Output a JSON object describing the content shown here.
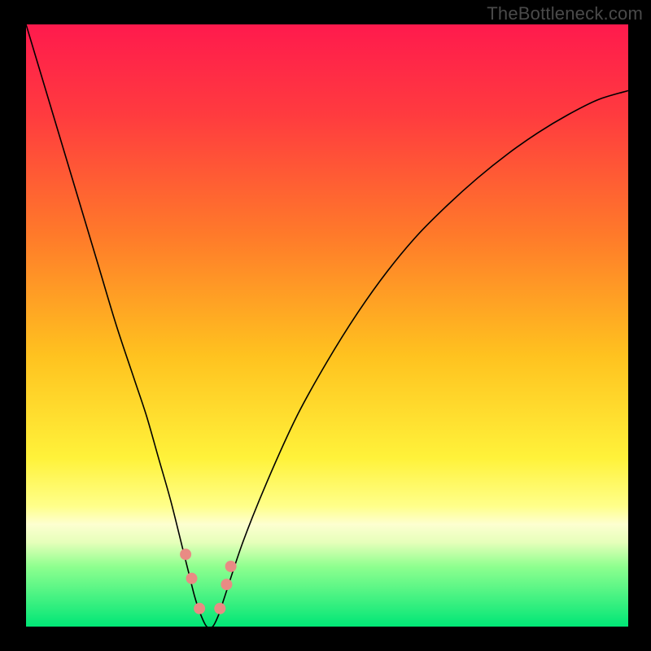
{
  "watermark": "TheBottleneck.com",
  "chart_data": {
    "type": "line",
    "title": "",
    "xlabel": "",
    "ylabel": "",
    "xlim": [
      0,
      100
    ],
    "ylim": [
      0,
      100
    ],
    "grid": false,
    "legend": false,
    "background_gradient": {
      "stops": [
        {
          "offset": 0.0,
          "color": "#ff1a4d"
        },
        {
          "offset": 0.15,
          "color": "#ff3b3f"
        },
        {
          "offset": 0.35,
          "color": "#ff7a2a"
        },
        {
          "offset": 0.55,
          "color": "#ffc21f"
        },
        {
          "offset": 0.72,
          "color": "#fff23a"
        },
        {
          "offset": 0.8,
          "color": "#ffff8a"
        },
        {
          "offset": 0.83,
          "color": "#fdffd0"
        },
        {
          "offset": 0.86,
          "color": "#e6ffba"
        },
        {
          "offset": 0.9,
          "color": "#8fff8f"
        },
        {
          "offset": 1.0,
          "color": "#00e676"
        }
      ]
    },
    "series": [
      {
        "name": "bottleneck-curve",
        "color": "#000000",
        "width": 1.6,
        "x": [
          0,
          3,
          6,
          9,
          12,
          15,
          18,
          20,
          22,
          24,
          26,
          27,
          28,
          29,
          30,
          31,
          32,
          33,
          36,
          40,
          45,
          50,
          55,
          60,
          65,
          70,
          75,
          80,
          85,
          90,
          95,
          100
        ],
        "y": [
          100,
          90,
          80,
          70,
          60,
          50,
          41,
          35,
          28,
          21,
          13,
          9,
          5,
          2,
          0,
          0,
          2,
          5,
          14,
          24,
          35,
          44,
          52,
          59,
          65,
          70,
          74.5,
          78.5,
          82,
          85,
          87.5,
          89
        ]
      }
    ],
    "markers": {
      "name": "bottleneck-markers",
      "color": "#e98b84",
      "size": 14,
      "points": [
        {
          "x": 26.5,
          "y": 12
        },
        {
          "x": 27.5,
          "y": 8
        },
        {
          "x": 28.8,
          "y": 3
        },
        {
          "x": 32.2,
          "y": 3
        },
        {
          "x": 33.3,
          "y": 7
        },
        {
          "x": 34.0,
          "y": 10
        }
      ]
    }
  }
}
